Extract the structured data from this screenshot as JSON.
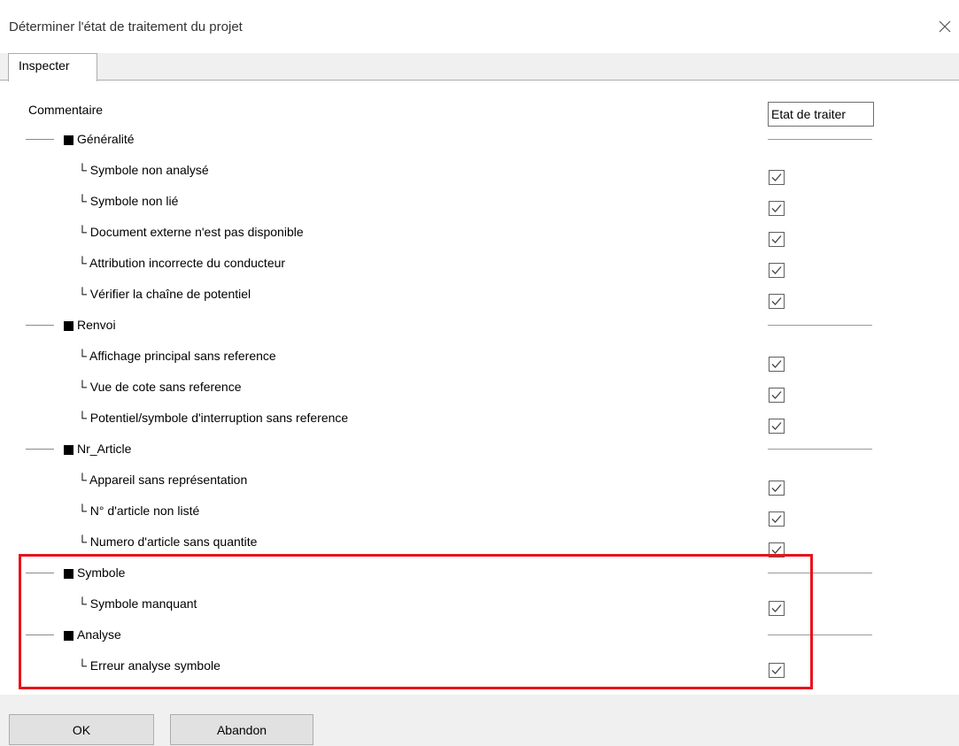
{
  "dialog": {
    "title": "Déterminer l'état de traitement du projet",
    "close_icon": "close-icon"
  },
  "tabs": [
    {
      "label": "Inspecter",
      "active": true
    }
  ],
  "columns": {
    "left": "Commentaire",
    "right": "Etat de traiter"
  },
  "rows": [
    {
      "type": "group",
      "label": "Généralité"
    },
    {
      "type": "item",
      "label": "└ Symbole non analysé",
      "checked": true
    },
    {
      "type": "item",
      "label": "└ Symbole non lié",
      "checked": true
    },
    {
      "type": "item",
      "label": "└ Document externe n'est pas disponible",
      "checked": true
    },
    {
      "type": "item",
      "label": "└ Attribution incorrecte du conducteur",
      "checked": true
    },
    {
      "type": "item",
      "label": "└ Vérifier la chaîne de potentiel",
      "checked": true
    },
    {
      "type": "group",
      "label": "Renvoi"
    },
    {
      "type": "item",
      "label": "└ Affichage principal sans reference",
      "checked": true
    },
    {
      "type": "item",
      "label": "└ Vue de cote sans reference",
      "checked": true
    },
    {
      "type": "item",
      "label": "└ Potentiel/symbole d'interruption sans reference",
      "checked": true
    },
    {
      "type": "group",
      "label": "Nr_Article"
    },
    {
      "type": "item",
      "label": "└ Appareil sans représentation",
      "checked": true
    },
    {
      "type": "item",
      "label": "└ N° d'article non listé",
      "checked": true
    },
    {
      "type": "item",
      "label": "└ Numero d'article sans quantite",
      "checked": true
    },
    {
      "type": "group",
      "label": "Symbole"
    },
    {
      "type": "item",
      "label": "└ Symbole manquant",
      "checked": true
    },
    {
      "type": "group",
      "label": "Analyse"
    },
    {
      "type": "item",
      "label": "└ Erreur analyse symbole",
      "checked": true
    }
  ],
  "buttons": {
    "ok": "OK",
    "cancel": "Abandon"
  },
  "colors": {
    "highlight": "#e8131b",
    "footer": "#f0f0f0"
  }
}
